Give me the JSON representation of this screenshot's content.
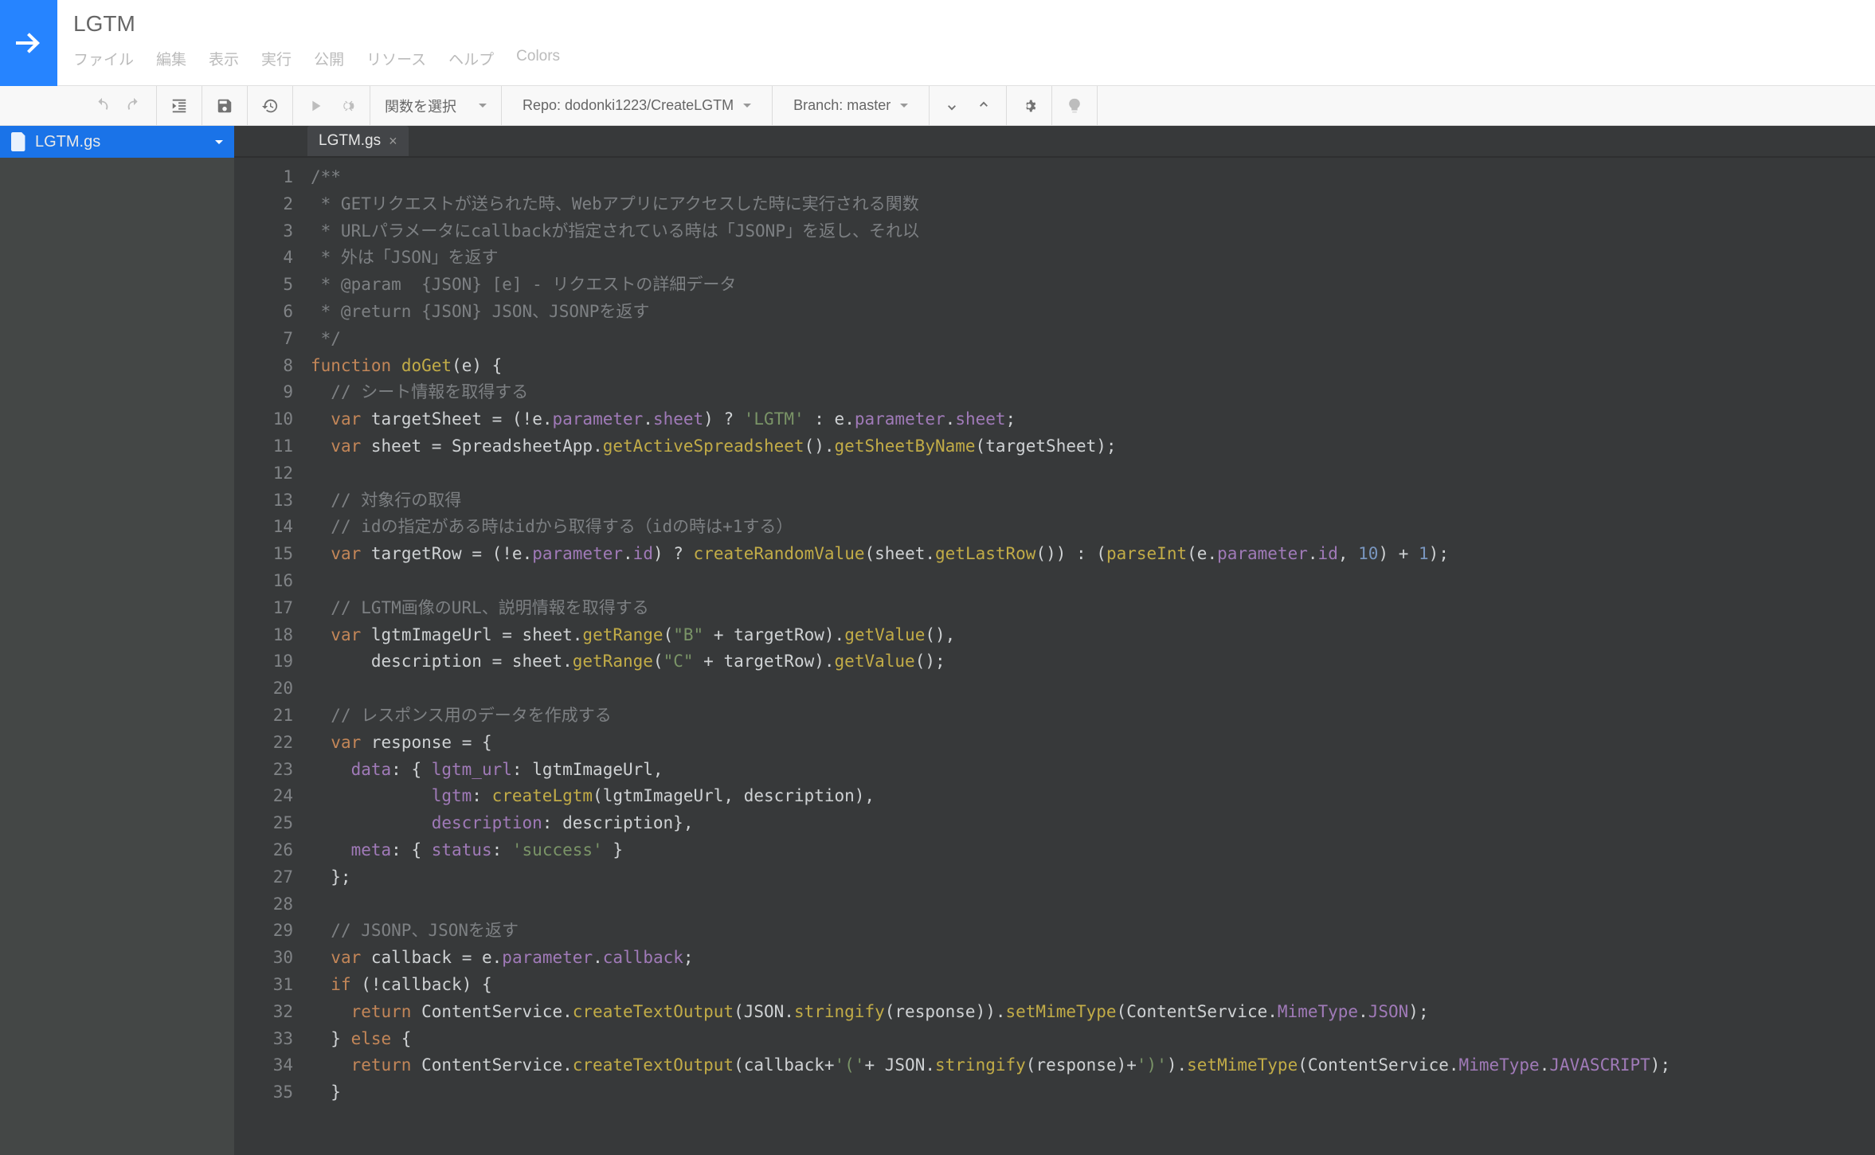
{
  "app": {
    "title": "LGTM"
  },
  "menu": {
    "file": "ファイル",
    "edit": "編集",
    "view": "表示",
    "run": "実行",
    "publish": "公開",
    "resource": "リソース",
    "help": "ヘルプ",
    "colors": "Colors"
  },
  "toolbar": {
    "function_select": "関数を選択",
    "repo": "Repo: dodonki1223/CreateLGTM",
    "branch": "Branch: master"
  },
  "sidebar": {
    "file": "LGTM.gs"
  },
  "tabs": {
    "active": "LGTM.gs"
  },
  "code": {
    "lines": [
      {
        "n": "1",
        "t": "cmt",
        "s": "/**"
      },
      {
        "n": "2",
        "t": "cmt",
        "s": " * GETリクエストが送られた時、Webアプリにアクセスした時に実行される関数"
      },
      {
        "n": "3",
        "t": "cmt",
        "s": " * URLパラメータにcallbackが指定されている時は「JSONP」を返し、それ以"
      },
      {
        "n": "4",
        "t": "cmt",
        "s": " * 外は「JSON」を返す"
      },
      {
        "n": "5",
        "t": "cmt",
        "s": " * @param  {JSON} [e] - リクエストの詳細データ"
      },
      {
        "n": "6",
        "t": "cmt",
        "s": " * @return {JSON} JSON、JSONPを返す"
      },
      {
        "n": "7",
        "t": "cmt",
        "s": " */"
      },
      {
        "n": "8",
        "t": "raw",
        "h": "<span class=\"kw\">function</span> <span class=\"fn\">doGet</span>(<span class=\"def\">e</span>) {"
      },
      {
        "n": "9",
        "t": "raw",
        "h": "  <span class=\"cmt\">// シート情報を取得する</span>"
      },
      {
        "n": "10",
        "t": "raw",
        "h": "  <span class=\"kw\">var</span> <span class=\"def\">targetSheet</span> = (!<span class=\"def\">e</span>.<span class=\"prop\">parameter</span>.<span class=\"prop\">sheet</span>) ? <span class=\"str\">'LGTM'</span> : <span class=\"def\">e</span>.<span class=\"prop\">parameter</span>.<span class=\"prop\">sheet</span>;"
      },
      {
        "n": "11",
        "t": "raw",
        "h": "  <span class=\"kw\">var</span> <span class=\"def\">sheet</span> = <span class=\"def\">SpreadsheetApp</span>.<span class=\"fn\">getActiveSpreadsheet</span>().<span class=\"fn\">getSheetByName</span>(<span class=\"def\">targetSheet</span>);"
      },
      {
        "n": "12",
        "t": "raw",
        "h": ""
      },
      {
        "n": "13",
        "t": "raw",
        "h": "  <span class=\"cmt\">// 対象行の取得</span>"
      },
      {
        "n": "14",
        "t": "raw",
        "h": "  <span class=\"cmt\">// idの指定がある時はidから取得する（idの時は+1する）</span>"
      },
      {
        "n": "15",
        "t": "raw",
        "h": "  <span class=\"kw\">var</span> <span class=\"def\">targetRow</span> = (!<span class=\"def\">e</span>.<span class=\"prop\">parameter</span>.<span class=\"prop\">id</span>) ? <span class=\"fn\">createRandomValue</span>(<span class=\"def\">sheet</span>.<span class=\"fn\">getLastRow</span>()) : (<span class=\"fn\">parseInt</span>(<span class=\"def\">e</span>.<span class=\"prop\">parameter</span>.<span class=\"prop\">id</span>, <span class=\"num\">10</span>) + <span class=\"num\">1</span>);"
      },
      {
        "n": "16",
        "t": "raw",
        "h": ""
      },
      {
        "n": "17",
        "t": "raw",
        "h": "  <span class=\"cmt\">// LGTM画像のURL、説明情報を取得する</span>"
      },
      {
        "n": "18",
        "t": "raw",
        "h": "  <span class=\"kw\">var</span> <span class=\"def\">lgtmImageUrl</span> = <span class=\"def\">sheet</span>.<span class=\"fn\">getRange</span>(<span class=\"str\">\"B\"</span> + <span class=\"def\">targetRow</span>).<span class=\"fn\">getValue</span>(),"
      },
      {
        "n": "19",
        "t": "raw",
        "h": "      <span class=\"def\">description</span> = <span class=\"def\">sheet</span>.<span class=\"fn\">getRange</span>(<span class=\"str\">\"C\"</span> + <span class=\"def\">targetRow</span>).<span class=\"fn\">getValue</span>();"
      },
      {
        "n": "20",
        "t": "raw",
        "h": ""
      },
      {
        "n": "21",
        "t": "raw",
        "h": "  <span class=\"cmt\">// レスポンス用のデータを作成する</span>"
      },
      {
        "n": "22",
        "t": "raw",
        "h": "  <span class=\"kw\">var</span> <span class=\"def\">response</span> = {"
      },
      {
        "n": "23",
        "t": "raw",
        "h": "    <span class=\"prop\">data</span>: { <span class=\"prop\">lgtm_url</span>: <span class=\"def\">lgtmImageUrl</span>,"
      },
      {
        "n": "24",
        "t": "raw",
        "h": "            <span class=\"prop\">lgtm</span>: <span class=\"fn\">createLgtm</span>(<span class=\"def\">lgtmImageUrl</span>, <span class=\"def\">description</span>),"
      },
      {
        "n": "25",
        "t": "raw",
        "h": "            <span class=\"prop\">description</span>: <span class=\"def\">description</span>},"
      },
      {
        "n": "26",
        "t": "raw",
        "h": "    <span class=\"prop\">meta</span>: { <span class=\"prop\">status</span>: <span class=\"str\">'success'</span> }"
      },
      {
        "n": "27",
        "t": "raw",
        "h": "  };"
      },
      {
        "n": "28",
        "t": "raw",
        "h": ""
      },
      {
        "n": "29",
        "t": "raw",
        "h": "  <span class=\"cmt\">// JSONP、JSONを返す</span>"
      },
      {
        "n": "30",
        "t": "raw",
        "h": "  <span class=\"kw\">var</span> <span class=\"def\">callback</span> = <span class=\"def\">e</span>.<span class=\"prop\">parameter</span>.<span class=\"prop\">callback</span>;"
      },
      {
        "n": "31",
        "t": "raw",
        "h": "  <span class=\"kw\">if</span> (!<span class=\"def\">callback</span>) {"
      },
      {
        "n": "32",
        "t": "raw",
        "h": "    <span class=\"kw\">return</span> <span class=\"def\">ContentService</span>.<span class=\"fn\">createTextOutput</span>(<span class=\"def\">JSON</span>.<span class=\"fn\">stringify</span>(<span class=\"def\">response</span>)).<span class=\"fn\">setMimeType</span>(<span class=\"def\">ContentService</span>.<span class=\"prop\">MimeType</span>.<span class=\"prop\">JSON</span>);"
      },
      {
        "n": "33",
        "t": "raw",
        "h": "  } <span class=\"kw\">else</span> {"
      },
      {
        "n": "34",
        "t": "raw",
        "h": "    <span class=\"kw\">return</span> <span class=\"def\">ContentService</span>.<span class=\"fn\">createTextOutput</span>(<span class=\"def\">callback</span>+<span class=\"str\">'('</span>+ <span class=\"def\">JSON</span>.<span class=\"fn\">stringify</span>(<span class=\"def\">response</span>)+<span class=\"str\">')'</span>).<span class=\"fn\">setMimeType</span>(<span class=\"def\">ContentService</span>.<span class=\"prop\">MimeType</span>.<span class=\"prop\">JAVASCRIPT</span>);"
      },
      {
        "n": "35",
        "t": "raw",
        "h": "  }"
      }
    ]
  }
}
